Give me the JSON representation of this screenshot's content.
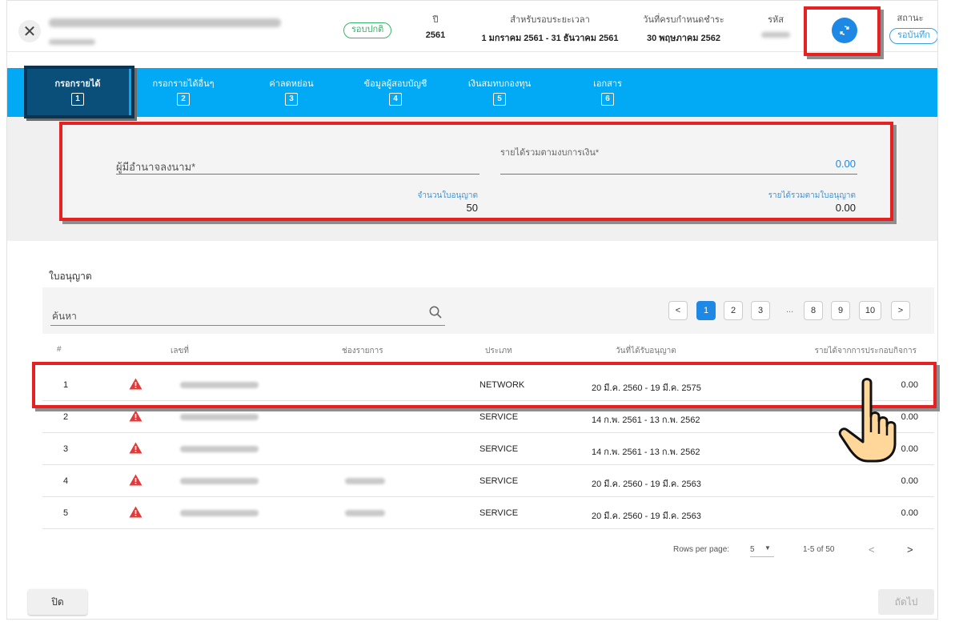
{
  "header": {
    "status_pill": "รอบปกติ",
    "year_label": "ปี",
    "year_value": "2561",
    "period_label": "สำหรับรอบระยะเวลา",
    "period_value": "1 มกราคม 2561 - 31 ธันวาคม 2561",
    "due_label": "วันที่ครบกำหนดชำระ",
    "due_value": "30 พฤษภาคม 2562",
    "code_label": "รหัส",
    "state_label": "สถานะ",
    "state_value": "รอบันทึก"
  },
  "tabs": [
    {
      "label": "กรอกรายได้",
      "num": "1"
    },
    {
      "label": "กรอกรายได้อื่นๆ",
      "num": "2"
    },
    {
      "label": "ค่าลดหย่อน",
      "num": "3"
    },
    {
      "label": "ข้อมูลผู้สอบบัญชี",
      "num": "4"
    },
    {
      "label": "เงินสมทบกองทุน",
      "num": "5"
    },
    {
      "label": "เอกสาร",
      "num": "6"
    }
  ],
  "form": {
    "signer_label": "ผู้มีอำนาจลงนาม*",
    "revenue_label": "รายได้รวมตามงบการเงิน*",
    "revenue_value": "0.00",
    "license_count_label": "จำนวนใบอนุญาต",
    "license_count_value": "50",
    "license_revenue_label": "รายได้รวมตามใบอนุญาต",
    "license_revenue_value": "0.00"
  },
  "section_title": "ใบอนุญาต",
  "search": {
    "placeholder": "ค้นหา"
  },
  "pagination": {
    "pages": [
      "1",
      "2",
      "3",
      "8",
      "9",
      "10"
    ],
    "active": "1",
    "dots": "...",
    "prev": "<",
    "next": ">"
  },
  "table": {
    "headers": [
      "#",
      "เลขที่",
      "ช่องรายการ",
      "ประเภท",
      "วันที่ได้รับอนุญาต",
      "รายได้จากการประกอบกิจการ"
    ],
    "rows": [
      {
        "num": "1",
        "type": "NETWORK",
        "date": "20 มี.ค. 2560 - 19 มี.ค. 2575",
        "amount": "0.00"
      },
      {
        "num": "2",
        "type": "SERVICE",
        "date": "14 ก.พ. 2561 - 13 ก.พ. 2562",
        "amount": "0.00"
      },
      {
        "num": "3",
        "type": "SERVICE",
        "date": "14 ก.พ. 2561 - 13 ก.พ. 2562",
        "amount": "0.00"
      },
      {
        "num": "4",
        "type": "SERVICE",
        "date": "20 มี.ค. 2560 - 19 มี.ค. 2563",
        "amount": "0.00"
      },
      {
        "num": "5",
        "type": "SERVICE",
        "date": "20 มี.ค. 2560 - 19 มี.ค. 2563",
        "amount": "0.00"
      }
    ]
  },
  "footer": {
    "rows_per_page_label": "Rows per page:",
    "rows_per_page_value": "5",
    "range": "1-5 of 50",
    "prev": "<",
    "next": ">",
    "close_label": "ปิด",
    "next_label": "ถัดไป"
  },
  "colors": {
    "accent": "#02a9f4",
    "highlight": "#e52121",
    "primary": "#1e88e5"
  }
}
